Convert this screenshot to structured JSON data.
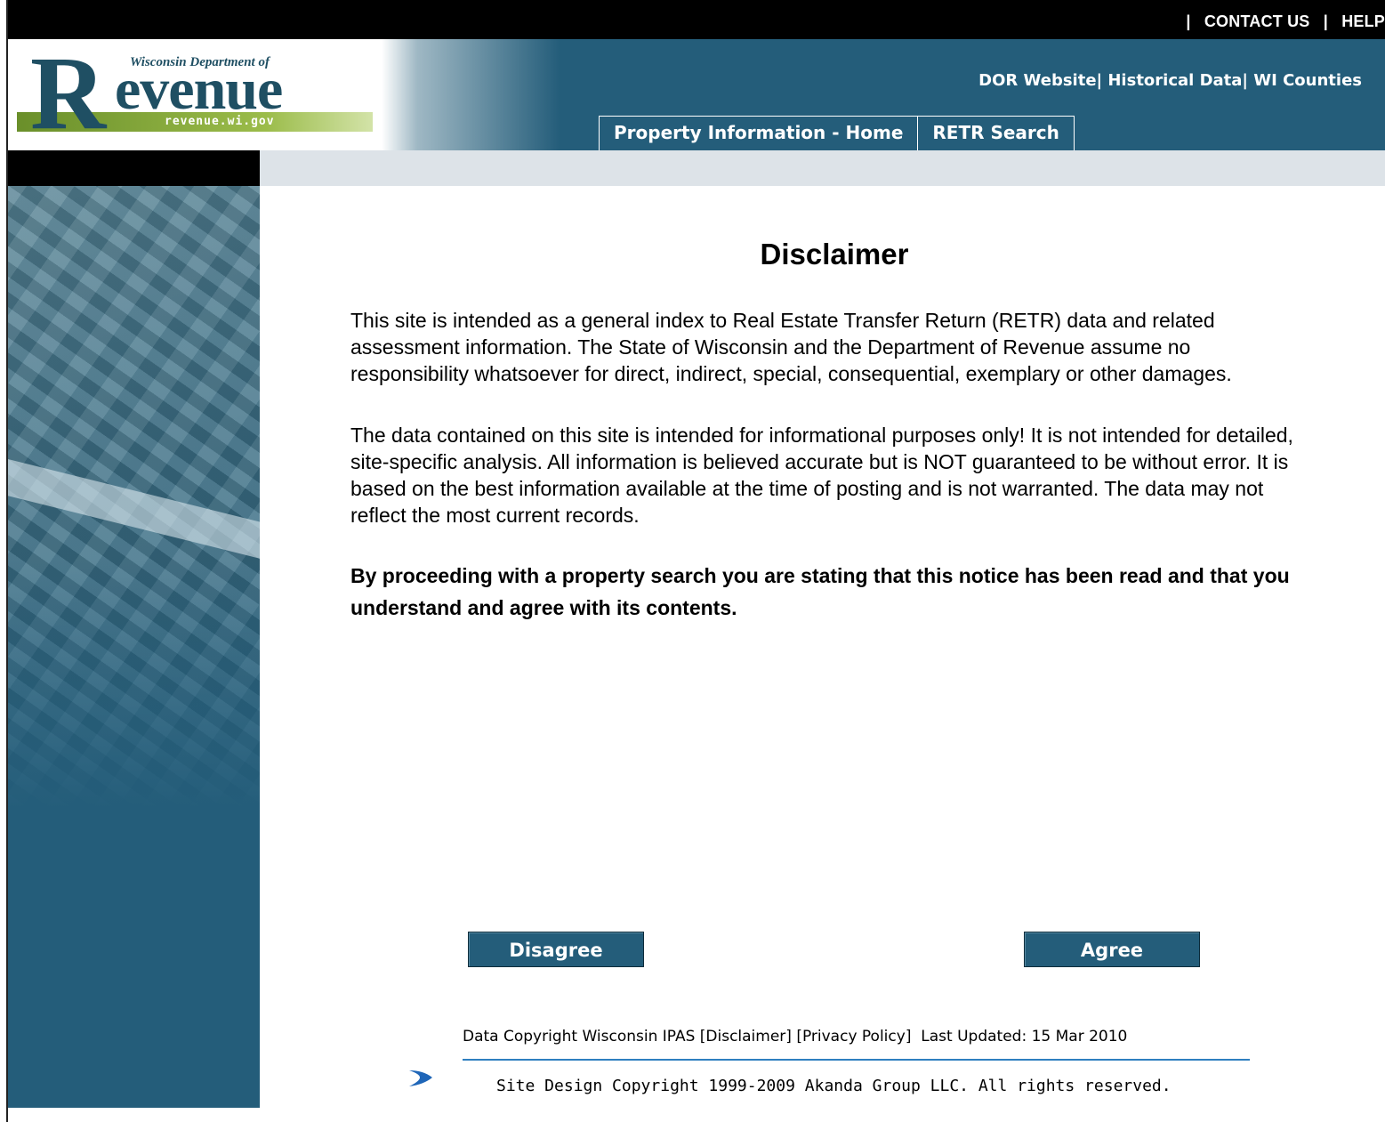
{
  "top_links": {
    "sep": "|",
    "contact": "CONTACT US",
    "help": "HELP"
  },
  "logo": {
    "top_line": "Wisconsin Department of",
    "letter": "R",
    "word": "evenue",
    "url": "revenue.wi.gov"
  },
  "header_links": {
    "text": "DOR Website| Historical Data| WI Counties"
  },
  "tabs": [
    {
      "label": "Property Information - Home"
    },
    {
      "label": "RETR Search"
    }
  ],
  "main": {
    "title": "Disclaimer",
    "para1": "This site is intended as a general index to Real Estate Transfer Return (RETR) data and related assessment information. The State of Wisconsin and the Department of Revenue assume no responsibility whatsoever for direct, indirect, special, consequential, exemplary or other damages.",
    "para2": "The data contained on this site is intended for informational purposes only! It is not intended for detailed, site-specific analysis. All information is believed accurate but is NOT guaranteed to be without error. It is based on the best information available at the time of posting and is not warranted. The data may not reflect the most current records.",
    "para3": "By proceeding with a property search you are stating that this notice has been read and that you understand and agree with its contents."
  },
  "buttons": {
    "disagree": "Disagree",
    "agree": "Agree"
  },
  "footer": {
    "copyright": "Data Copyright Wisconsin IPAS",
    "disclaimer": "[Disclaimer]",
    "privacy": "[Privacy Policy]",
    "updated": "Last Updated: 15 Mar 2010",
    "site_design": "Site Design Copyright 1999-2009 Akanda Group LLC. All rights reserved."
  },
  "colors": {
    "brand": "#245d7a",
    "strip": "#dde3e8",
    "footer_line": "#2f7fc0"
  }
}
